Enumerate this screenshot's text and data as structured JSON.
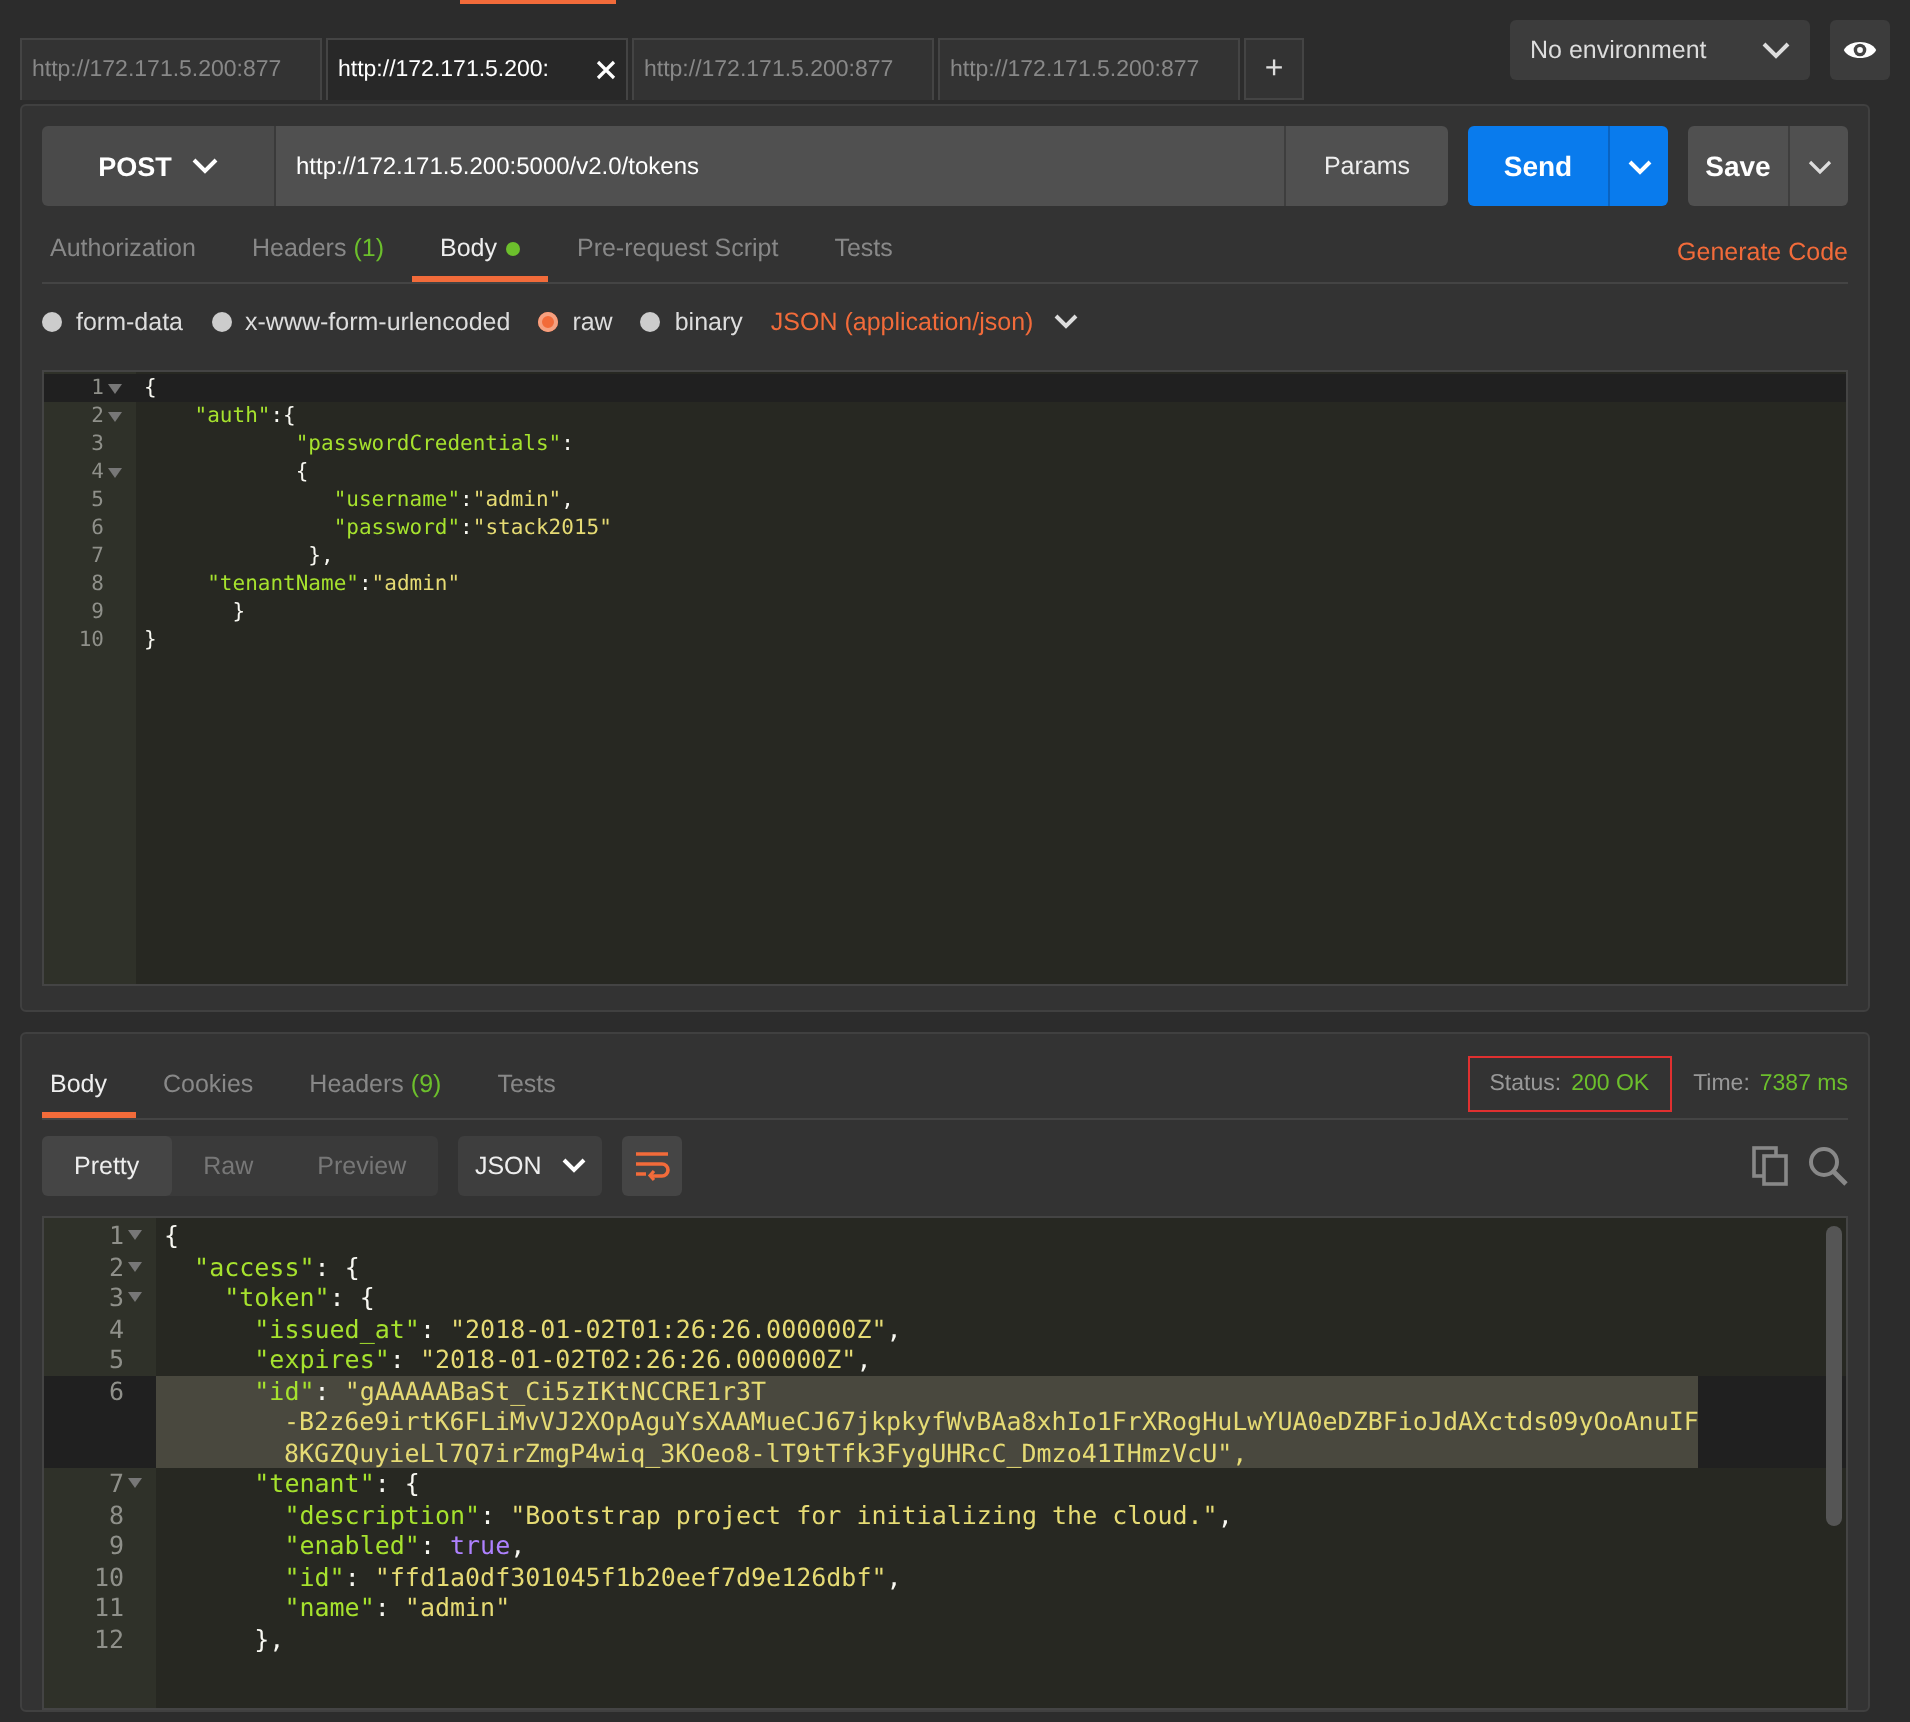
{
  "tabs": [
    {
      "label": "http://172.171.5.200:877",
      "selected": false,
      "closable": false
    },
    {
      "label": "http://172.171.5.200:",
      "selected": true,
      "closable": true
    },
    {
      "label": "http://172.171.5.200:877",
      "selected": false,
      "closable": false
    },
    {
      "label": "http://172.171.5.200:877",
      "selected": false,
      "closable": false
    }
  ],
  "new_tab": "+",
  "environment": "No environment",
  "request": {
    "method": "POST",
    "url": "http://172.171.5.200:5000/v2.0/tokens",
    "params": "Params",
    "send": "Send",
    "save": "Save",
    "tabs": [
      {
        "label": "Authorization",
        "selected": false,
        "dot": false
      },
      {
        "label": "Headers",
        "count": "(1)",
        "selected": false,
        "dot": false
      },
      {
        "label": "Body",
        "dot": true,
        "selected": true
      },
      {
        "label": "Pre-request Script",
        "selected": false,
        "dot": false
      },
      {
        "label": "Tests",
        "selected": false,
        "dot": false
      }
    ],
    "generate_code": "Generate Code",
    "body_types": [
      {
        "label": "form-data",
        "selected": false
      },
      {
        "label": "x-www-form-urlencoded",
        "selected": false
      },
      {
        "label": "raw",
        "selected": true
      },
      {
        "label": "binary",
        "selected": false
      }
    ],
    "content_type": "JSON (application/json)",
    "editor": [
      {
        "num": "1",
        "foldable": true,
        "segments": [
          {
            "t": "{",
            "kind": "punct"
          }
        ]
      },
      {
        "num": "2",
        "foldable": true,
        "segments": [
          {
            "t": "    \"auth\"",
            "kind": "key"
          },
          {
            "t": ":{",
            "kind": "punct"
          }
        ]
      },
      {
        "num": "3",
        "foldable": false,
        "segments": [
          {
            "t": "            \"passwordCredentials\"",
            "kind": "key"
          },
          {
            "t": ":",
            "kind": "punct"
          }
        ]
      },
      {
        "num": "4",
        "foldable": true,
        "segments": [
          {
            "t": "            {",
            "kind": "punct"
          }
        ]
      },
      {
        "num": "5",
        "foldable": false,
        "segments": [
          {
            "t": "               \"username\"",
            "kind": "key"
          },
          {
            "t": ":",
            "kind": "punct"
          },
          {
            "t": "\"admin\"",
            "kind": "string"
          },
          {
            "t": ",",
            "kind": "punct"
          }
        ]
      },
      {
        "num": "6",
        "foldable": false,
        "segments": [
          {
            "t": "               \"password\"",
            "kind": "key"
          },
          {
            "t": ":",
            "kind": "punct"
          },
          {
            "t": "\"stack2015\"",
            "kind": "string"
          }
        ]
      },
      {
        "num": "7",
        "foldable": false,
        "segments": [
          {
            "t": "             },",
            "kind": "punct"
          }
        ]
      },
      {
        "num": "8",
        "foldable": false,
        "segments": [
          {
            "t": "     \"tenantName\"",
            "kind": "key"
          },
          {
            "t": ":",
            "kind": "punct"
          },
          {
            "t": "\"admin\"",
            "kind": "string"
          }
        ]
      },
      {
        "num": "9",
        "foldable": false,
        "segments": [
          {
            "t": "       }",
            "kind": "punct"
          }
        ]
      },
      {
        "num": "10",
        "foldable": false,
        "segments": [
          {
            "t": "}",
            "kind": "punct"
          }
        ]
      }
    ]
  },
  "response": {
    "tabs": [
      {
        "label": "Body",
        "selected": true
      },
      {
        "label": "Cookies",
        "selected": false
      },
      {
        "label": "Headers",
        "count": "(9)",
        "selected": false
      },
      {
        "label": "Tests",
        "selected": false
      }
    ],
    "status_label": "Status:",
    "status": "200 OK",
    "time_label": "Time:",
    "time": "7387 ms",
    "views": [
      {
        "label": "Pretty",
        "selected": true
      },
      {
        "label": "Raw",
        "selected": false
      },
      {
        "label": "Preview",
        "selected": false
      }
    ],
    "format": "JSON",
    "editor": [
      {
        "num": "1",
        "foldable": true,
        "selected": false,
        "segments": [
          {
            "t": "{",
            "kind": "punct"
          }
        ]
      },
      {
        "num": "2",
        "foldable": true,
        "selected": false,
        "segments": [
          {
            "t": "  \"access\"",
            "kind": "key"
          },
          {
            "t": ": {",
            "kind": "punct"
          }
        ]
      },
      {
        "num": "3",
        "foldable": true,
        "selected": false,
        "segments": [
          {
            "t": "    \"token\"",
            "kind": "key"
          },
          {
            "t": ": {",
            "kind": "punct"
          }
        ]
      },
      {
        "num": "4",
        "foldable": false,
        "selected": false,
        "segments": [
          {
            "t": "      \"issued_at\"",
            "kind": "key"
          },
          {
            "t": ": ",
            "kind": "punct"
          },
          {
            "t": "\"2018-01-02T01:26:26.000000Z\"",
            "kind": "string"
          },
          {
            "t": ",",
            "kind": "punct"
          }
        ]
      },
      {
        "num": "5",
        "foldable": false,
        "selected": false,
        "segments": [
          {
            "t": "      \"expires\"",
            "kind": "key"
          },
          {
            "t": ": ",
            "kind": "punct"
          },
          {
            "t": "\"2018-01-02T02:26:26.000000Z\"",
            "kind": "string"
          },
          {
            "t": ",",
            "kind": "punct"
          }
        ]
      },
      {
        "num": "6",
        "foldable": false,
        "selected": true,
        "segments": [
          {
            "t": "      \"id\"",
            "kind": "key"
          },
          {
            "t": ": ",
            "kind": "punct"
          },
          {
            "t": "\"gAAAAABaSt_Ci5zIKtNCCRE1r3T",
            "kind": "string"
          }
        ],
        "continuation": [
          "-B2z6e9irtK6FLiMvVJ2XOpAguYsXAAMueCJ67jkpkyfWvBAa8xhIo1FrXRogHuLwYUA0eDZBFioJdAXctds09yOoAnuIF",
          "8KGZQuyieLl7Q7irZmgP4wiq_3KOeo8-lT9tTfk3FygUHRcC_Dmzo41IHmzVcU\","
        ]
      },
      {
        "num": "7",
        "foldable": true,
        "selected": false,
        "segments": [
          {
            "t": "      \"tenant\"",
            "kind": "key"
          },
          {
            "t": ": {",
            "kind": "punct"
          }
        ]
      },
      {
        "num": "8",
        "foldable": false,
        "selected": false,
        "segments": [
          {
            "t": "        \"description\"",
            "kind": "key"
          },
          {
            "t": ": ",
            "kind": "punct"
          },
          {
            "t": "\"Bootstrap project for initializing the cloud.\"",
            "kind": "string"
          },
          {
            "t": ",",
            "kind": "punct"
          }
        ]
      },
      {
        "num": "9",
        "foldable": false,
        "selected": false,
        "segments": [
          {
            "t": "        \"enabled\"",
            "kind": "key"
          },
          {
            "t": ": ",
            "kind": "punct"
          },
          {
            "t": "true",
            "kind": "bool"
          },
          {
            "t": ",",
            "kind": "punct"
          }
        ]
      },
      {
        "num": "10",
        "foldable": false,
        "selected": false,
        "segments": [
          {
            "t": "        \"id\"",
            "kind": "key"
          },
          {
            "t": ": ",
            "kind": "punct"
          },
          {
            "t": "\"ffd1a0df301045f1b20eef7d9e126dbf\"",
            "kind": "string"
          },
          {
            "t": ",",
            "kind": "punct"
          }
        ]
      },
      {
        "num": "11",
        "foldable": false,
        "selected": false,
        "segments": [
          {
            "t": "        \"name\"",
            "kind": "key"
          },
          {
            "t": ": ",
            "kind": "punct"
          },
          {
            "t": "\"admin\"",
            "kind": "string"
          }
        ]
      },
      {
        "num": "12",
        "foldable": false,
        "selected": false,
        "segments": [
          {
            "t": "      },",
            "kind": "punct"
          }
        ]
      }
    ]
  }
}
